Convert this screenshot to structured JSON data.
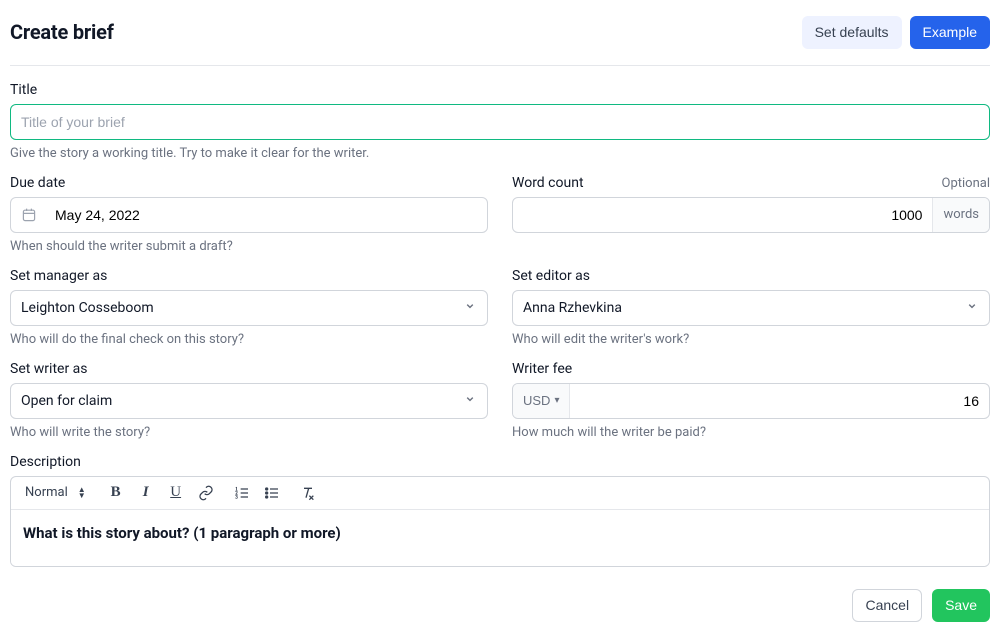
{
  "header": {
    "title": "Create brief",
    "set_defaults_label": "Set defaults",
    "example_label": "Example"
  },
  "title_field": {
    "label": "Title",
    "placeholder": "Title of your brief",
    "value": "",
    "helper": "Give the story a working title. Try to make it clear for the writer."
  },
  "due_date": {
    "label": "Due date",
    "value": "May 24, 2022",
    "helper": "When should the writer submit a draft?"
  },
  "word_count": {
    "label": "Word count",
    "optional_label": "Optional",
    "value": "1000",
    "unit_label": "words"
  },
  "manager": {
    "label": "Set manager as",
    "value": "Leighton Cosseboom",
    "helper": "Who will do the final check on this story?"
  },
  "editor": {
    "label": "Set editor as",
    "value": "Anna Rzhevkina",
    "helper": "Who will edit the writer's work?"
  },
  "writer": {
    "label": "Set writer as",
    "value": "Open for claim",
    "helper": "Who will write the story?"
  },
  "fee": {
    "label": "Writer fee",
    "currency": "USD",
    "value": "16",
    "helper": "How much will the writer be paid?"
  },
  "description": {
    "label": "Description",
    "toolbar": {
      "format_label": "Normal"
    },
    "content": "What is this story about? (1 paragraph or more)"
  },
  "footer": {
    "cancel_label": "Cancel",
    "save_label": "Save"
  }
}
